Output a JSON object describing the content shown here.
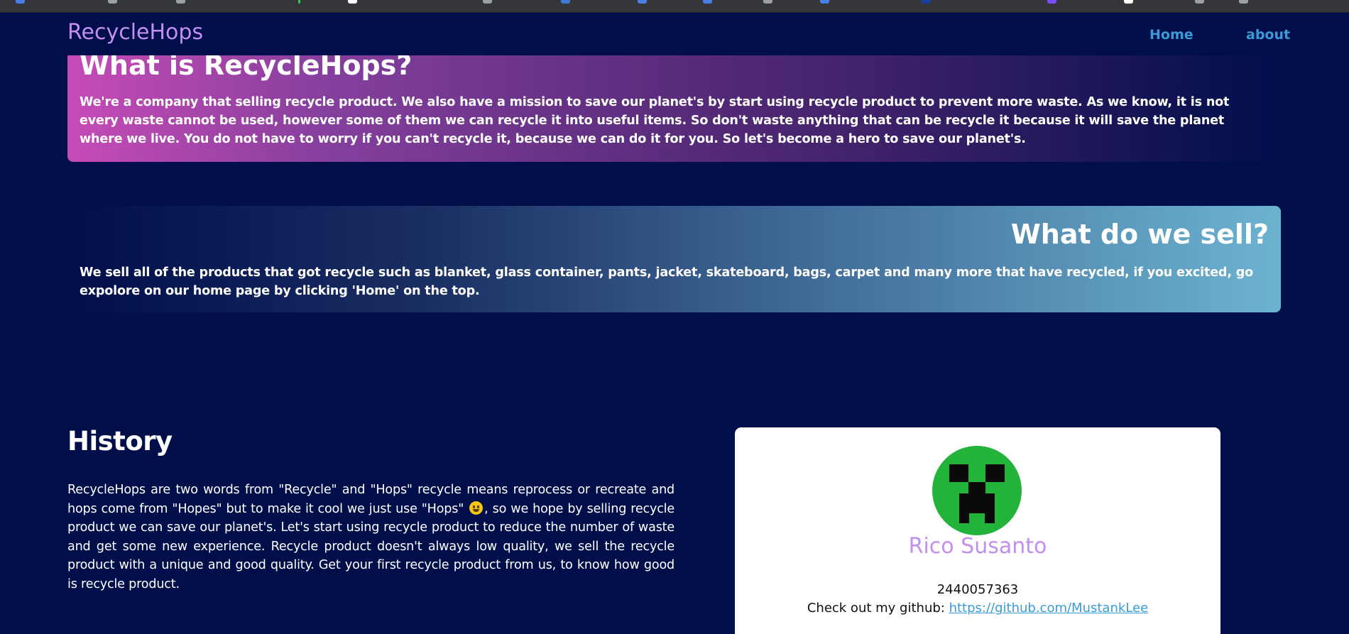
{
  "navbar": {
    "brand": "RecycleHops",
    "links": [
      {
        "label": "Home"
      },
      {
        "label": "about"
      }
    ]
  },
  "about": {
    "intro": {
      "heading": "What is RecycleHops?",
      "text": "We're a company that selling recycle product. We also have a mission to save our planet's by start using recycle product to prevent more waste. As we know, it is not every waste cannot be used, however some of them we can recycle it into useful items. So don't waste anything that can be recycle it because it will save the planet where we live. You do not have to worry if you can't recycle it, because we can do it for you. So let's become a hero to save our planet's."
    },
    "sell": {
      "heading": "What do we sell?",
      "text": "We sell all of the products that got recycle such as blanket, glass container, pants, jacket, skateboard, bags, carpet and many more that have recycled, if you excited, go expolore on our home page by clicking 'Home' on the top."
    }
  },
  "history": {
    "title": "History",
    "text_before_emoji": "RecycleHops are two words from \"Recycle\" and \"Hops\" recycle means reprocess or recreate and hops come from \"Hopes\" but to make it cool we just use \"Hops\"",
    "text_after_emoji": ", so we hope by selling recycle product we can save our planet's. Let's start using recycle product to reduce the number of waste and get some new experience. Recycle product doesn't always low quality, we sell the recycle product with a unique and good quality. Get your first recycle product from us, to know how good is recycle product."
  },
  "profile": {
    "name": "Rico Susanto",
    "id": "2440057363",
    "github_prefix": "Check out my github:",
    "github_url": "https://github.com/MustankLee"
  },
  "colors": {
    "background": "#000e4a",
    "brand": "#c38ef2",
    "link": "#3a9bd9",
    "avatar_green": "#21b33a"
  }
}
